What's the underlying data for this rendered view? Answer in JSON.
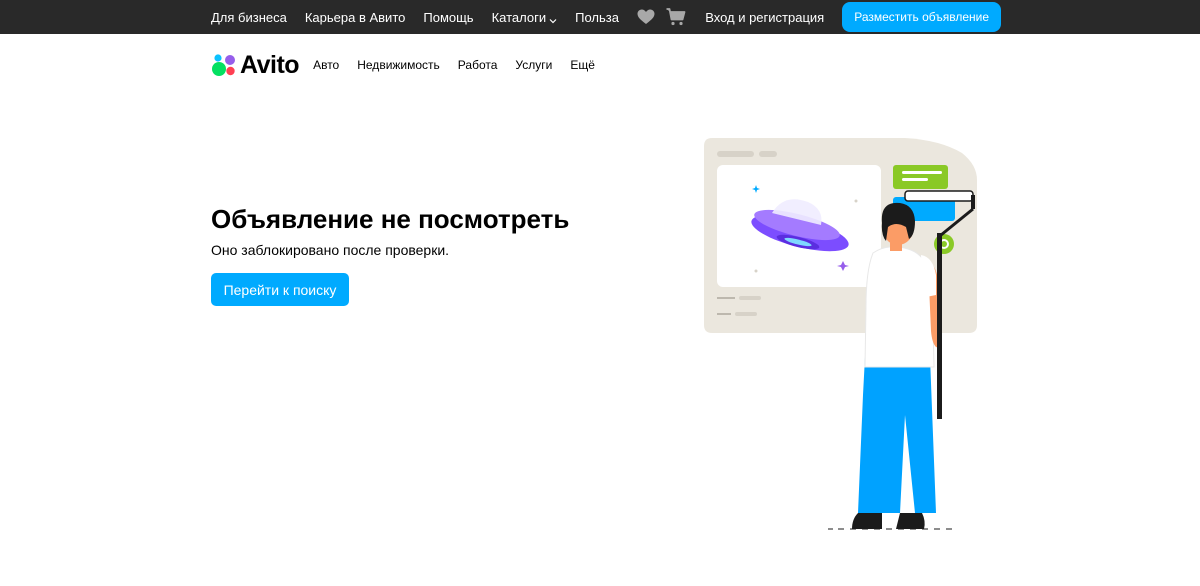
{
  "topbar": {
    "links": [
      {
        "label": "Для бизнеса"
      },
      {
        "label": "Карьера в Авито"
      },
      {
        "label": "Помощь"
      },
      {
        "label": "Каталоги",
        "has_dropdown": true
      },
      {
        "label": "Польза"
      }
    ],
    "favorites_icon": "heart-icon",
    "cart_icon": "cart-icon",
    "login_label": "Вход и регистрация",
    "post_button_label": "Разместить объявление"
  },
  "mainnav": {
    "logo_text": "Avito",
    "categories": [
      "Авто",
      "Недвижимость",
      "Работа",
      "Услуги",
      "Ещё"
    ]
  },
  "content": {
    "title": "Объявление не посмотреть",
    "subtitle": "Оно заблокировано после проверки.",
    "search_button_label": "Перейти к поиску"
  },
  "colors": {
    "topbar_bg": "#292929",
    "accent": "#00aaff",
    "logo_green": "#04e061",
    "logo_blue": "#0ac2ff",
    "logo_red": "#ff4053",
    "logo_purple": "#965eeb"
  }
}
